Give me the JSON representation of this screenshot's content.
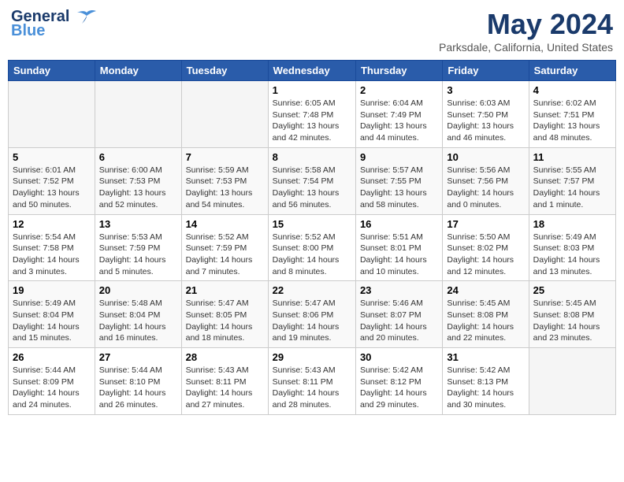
{
  "header": {
    "logo_line1": "General",
    "logo_line2": "Blue",
    "title": "May 2024",
    "subtitle": "Parksdale, California, United States"
  },
  "weekdays": [
    "Sunday",
    "Monday",
    "Tuesday",
    "Wednesday",
    "Thursday",
    "Friday",
    "Saturday"
  ],
  "weeks": [
    [
      {
        "day": "",
        "info": ""
      },
      {
        "day": "",
        "info": ""
      },
      {
        "day": "",
        "info": ""
      },
      {
        "day": "1",
        "info": "Sunrise: 6:05 AM\nSunset: 7:48 PM\nDaylight: 13 hours\nand 42 minutes."
      },
      {
        "day": "2",
        "info": "Sunrise: 6:04 AM\nSunset: 7:49 PM\nDaylight: 13 hours\nand 44 minutes."
      },
      {
        "day": "3",
        "info": "Sunrise: 6:03 AM\nSunset: 7:50 PM\nDaylight: 13 hours\nand 46 minutes."
      },
      {
        "day": "4",
        "info": "Sunrise: 6:02 AM\nSunset: 7:51 PM\nDaylight: 13 hours\nand 48 minutes."
      }
    ],
    [
      {
        "day": "5",
        "info": "Sunrise: 6:01 AM\nSunset: 7:52 PM\nDaylight: 13 hours\nand 50 minutes."
      },
      {
        "day": "6",
        "info": "Sunrise: 6:00 AM\nSunset: 7:53 PM\nDaylight: 13 hours\nand 52 minutes."
      },
      {
        "day": "7",
        "info": "Sunrise: 5:59 AM\nSunset: 7:53 PM\nDaylight: 13 hours\nand 54 minutes."
      },
      {
        "day": "8",
        "info": "Sunrise: 5:58 AM\nSunset: 7:54 PM\nDaylight: 13 hours\nand 56 minutes."
      },
      {
        "day": "9",
        "info": "Sunrise: 5:57 AM\nSunset: 7:55 PM\nDaylight: 13 hours\nand 58 minutes."
      },
      {
        "day": "10",
        "info": "Sunrise: 5:56 AM\nSunset: 7:56 PM\nDaylight: 14 hours\nand 0 minutes."
      },
      {
        "day": "11",
        "info": "Sunrise: 5:55 AM\nSunset: 7:57 PM\nDaylight: 14 hours\nand 1 minute."
      }
    ],
    [
      {
        "day": "12",
        "info": "Sunrise: 5:54 AM\nSunset: 7:58 PM\nDaylight: 14 hours\nand 3 minutes."
      },
      {
        "day": "13",
        "info": "Sunrise: 5:53 AM\nSunset: 7:59 PM\nDaylight: 14 hours\nand 5 minutes."
      },
      {
        "day": "14",
        "info": "Sunrise: 5:52 AM\nSunset: 7:59 PM\nDaylight: 14 hours\nand 7 minutes."
      },
      {
        "day": "15",
        "info": "Sunrise: 5:52 AM\nSunset: 8:00 PM\nDaylight: 14 hours\nand 8 minutes."
      },
      {
        "day": "16",
        "info": "Sunrise: 5:51 AM\nSunset: 8:01 PM\nDaylight: 14 hours\nand 10 minutes."
      },
      {
        "day": "17",
        "info": "Sunrise: 5:50 AM\nSunset: 8:02 PM\nDaylight: 14 hours\nand 12 minutes."
      },
      {
        "day": "18",
        "info": "Sunrise: 5:49 AM\nSunset: 8:03 PM\nDaylight: 14 hours\nand 13 minutes."
      }
    ],
    [
      {
        "day": "19",
        "info": "Sunrise: 5:49 AM\nSunset: 8:04 PM\nDaylight: 14 hours\nand 15 minutes."
      },
      {
        "day": "20",
        "info": "Sunrise: 5:48 AM\nSunset: 8:04 PM\nDaylight: 14 hours\nand 16 minutes."
      },
      {
        "day": "21",
        "info": "Sunrise: 5:47 AM\nSunset: 8:05 PM\nDaylight: 14 hours\nand 18 minutes."
      },
      {
        "day": "22",
        "info": "Sunrise: 5:47 AM\nSunset: 8:06 PM\nDaylight: 14 hours\nand 19 minutes."
      },
      {
        "day": "23",
        "info": "Sunrise: 5:46 AM\nSunset: 8:07 PM\nDaylight: 14 hours\nand 20 minutes."
      },
      {
        "day": "24",
        "info": "Sunrise: 5:45 AM\nSunset: 8:08 PM\nDaylight: 14 hours\nand 22 minutes."
      },
      {
        "day": "25",
        "info": "Sunrise: 5:45 AM\nSunset: 8:08 PM\nDaylight: 14 hours\nand 23 minutes."
      }
    ],
    [
      {
        "day": "26",
        "info": "Sunrise: 5:44 AM\nSunset: 8:09 PM\nDaylight: 14 hours\nand 24 minutes."
      },
      {
        "day": "27",
        "info": "Sunrise: 5:44 AM\nSunset: 8:10 PM\nDaylight: 14 hours\nand 26 minutes."
      },
      {
        "day": "28",
        "info": "Sunrise: 5:43 AM\nSunset: 8:11 PM\nDaylight: 14 hours\nand 27 minutes."
      },
      {
        "day": "29",
        "info": "Sunrise: 5:43 AM\nSunset: 8:11 PM\nDaylight: 14 hours\nand 28 minutes."
      },
      {
        "day": "30",
        "info": "Sunrise: 5:42 AM\nSunset: 8:12 PM\nDaylight: 14 hours\nand 29 minutes."
      },
      {
        "day": "31",
        "info": "Sunrise: 5:42 AM\nSunset: 8:13 PM\nDaylight: 14 hours\nand 30 minutes."
      },
      {
        "day": "",
        "info": ""
      }
    ]
  ]
}
